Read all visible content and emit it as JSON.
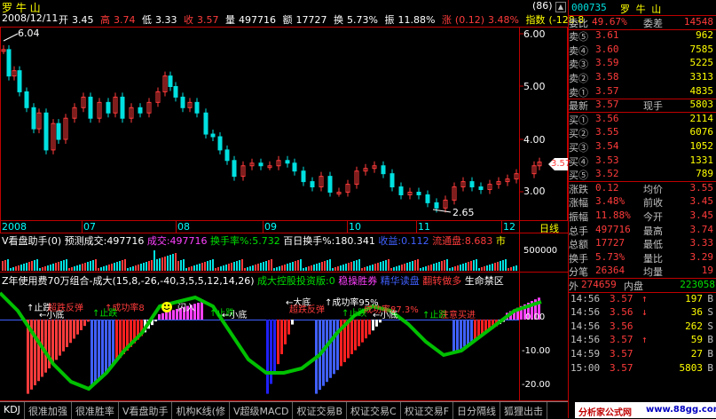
{
  "header": {
    "stock_name": "罗 牛 山",
    "top_right_label": "(86)",
    "date": "2008/12/11",
    "open_label": "开",
    "open": "3.45",
    "high_label": "高",
    "high": "3.74",
    "low_label": "低",
    "low": "3.33",
    "close_label": "收",
    "close": "3.57",
    "volume_label": "量",
    "volume": "497716",
    "amount_label": "额",
    "amount": "17727",
    "turnover_label": "换",
    "turnover": "5.73%",
    "amplitude_label": "振",
    "amplitude": "11.88%",
    "change_label": "涨",
    "change": "(0.12)",
    "change_pct": "3.48%",
    "index_label": "指数",
    "index": "(-128.8"
  },
  "main_chart": {
    "price_axis": [
      "6.00",
      "5.00",
      "4.00",
      "3.00"
    ],
    "max_label": "6.04",
    "min_label": "2.65",
    "current_price_tag": "3.57",
    "months": [
      "2008",
      "07",
      "08",
      "09",
      "10",
      "11",
      "12"
    ],
    "period_label": "日线"
  },
  "volume_panel": {
    "indicator_name": "V看盘助手(0)",
    "predict_label": "预测成交:",
    "predict_value": "497716",
    "deal_label": "成交:",
    "deal_value": "497716",
    "turnover_rate_label": "换手率%:",
    "turnover_rate_value": "5.732",
    "hundred_day_label": "百日换手%:",
    "hundred_day_value": "180.341",
    "profit_label": "收益:",
    "profit_value": "0.112",
    "float_label": "流通盘:",
    "float_value": "8.683",
    "market_label": "市",
    "axis_value": "500000"
  },
  "indicator_panel": {
    "formula_title": "Z年使用费70万组合-成大",
    "params": "(15,8,-26,-40,3,5,5,12,14,26)",
    "tag_green": "成大控股投资版:0",
    "tag_purple": "稳操胜券",
    "tag_blue": "精华读盘",
    "tag_red": "翻转做多",
    "tag_white": "生命禁区",
    "axis": [
      "0.00",
      "-10.00",
      "-20.00"
    ],
    "annotations": [
      {
        "text": "↑止跌",
        "cls": "wht"
      },
      {
        "text": "←小底",
        "cls": "wht"
      },
      {
        "text": "超跌反弹",
        "cls": "red"
      },
      {
        "text": "↑成功率8",
        "cls": "red"
      },
      {
        "text": "↑止跌",
        "cls": "grn"
      },
      {
        "text": "闪入",
        "cls": "wht"
      },
      {
        "text": "↑止跌",
        "cls": "grn"
      },
      {
        "text": "←小底",
        "cls": "wht"
      },
      {
        "text": "←大底",
        "cls": "wht"
      },
      {
        "text": "↑成功率95%",
        "cls": "wht"
      },
      {
        "text": "超跌反弹",
        "cls": "red"
      },
      {
        "text": "↑止跌",
        "cls": "grn"
      },
      {
        "text": "←小底",
        "cls": "wht"
      },
      {
        "text": "成功率87.3%",
        "cls": "red"
      },
      {
        "text": "↑止跌",
        "cls": "grn"
      },
      {
        "text": "注意买进",
        "cls": "red"
      }
    ]
  },
  "quote_panel": {
    "code": "000735",
    "name": "罗 牛 山",
    "ratio_label": "委比",
    "ratio": "49.67%",
    "diff_label": "委差",
    "diff": "14548",
    "asks": [
      {
        "label": "卖⑤",
        "price": "3.61",
        "vol": "962"
      },
      {
        "label": "卖④",
        "price": "3.60",
        "vol": "7585"
      },
      {
        "label": "卖③",
        "price": "3.59",
        "vol": "5225"
      },
      {
        "label": "卖②",
        "price": "3.58",
        "vol": "3313"
      },
      {
        "label": "卖①",
        "price": "3.57",
        "vol": "4835"
      }
    ],
    "last_label": "最新",
    "last": "3.57",
    "hand_label": "现手",
    "hand": "5803",
    "bids": [
      {
        "label": "买①",
        "price": "3.56",
        "vol": "2114"
      },
      {
        "label": "买②",
        "price": "3.55",
        "vol": "6076"
      },
      {
        "label": "买③",
        "price": "3.54",
        "vol": "1052"
      },
      {
        "label": "买④",
        "price": "3.53",
        "vol": "1331"
      },
      {
        "label": "买⑤",
        "price": "3.52",
        "vol": "789"
      }
    ],
    "stats": [
      {
        "l1": "涨跌",
        "v1": "0.12",
        "l2": "均价",
        "v2": "3.55"
      },
      {
        "l1": "涨幅",
        "v1": "3.48%",
        "l2": "前收",
        "v2": "3.45"
      },
      {
        "l1": "振幅",
        "v1": "11.88%",
        "l2": "今开",
        "v2": "3.45"
      },
      {
        "l1": "总手",
        "v1": "497716",
        "l2": "最高",
        "v2": "3.74"
      },
      {
        "l1": "总额",
        "v1": "17727",
        "l2": "最低",
        "v2": "3.33"
      },
      {
        "l1": "换手",
        "v1": "5.73%",
        "l2": "量比",
        "v2": "3.29"
      },
      {
        "l1": "分笔",
        "v1": "26364",
        "l2": "均量",
        "v2": "19"
      }
    ],
    "outer_label": "外",
    "outer": "274659",
    "inner_label": "内盘",
    "inner": "223058",
    "ticks": [
      {
        "time": "14:56",
        "price": "3.57",
        "dir": "↑",
        "vol": "197",
        "side": "B"
      },
      {
        "time": "14:56",
        "price": "3.56",
        "dir": "↓",
        "vol": "36",
        "side": "S"
      },
      {
        "time": "14:56",
        "price": "3.56",
        "dir": "",
        "vol": "262",
        "side": "S"
      },
      {
        "time": "14:56",
        "price": "3.57",
        "dir": "↑",
        "vol": "59",
        "side": "B"
      },
      {
        "time": "14:59",
        "price": "3.57",
        "dir": "",
        "vol": "27",
        "side": "B"
      },
      {
        "time": "15:00",
        "price": "3.57",
        "dir": "",
        "vol": "5803",
        "side": "B"
      }
    ]
  },
  "tabs": [
    "KDJ",
    "很准加强",
    "很准胜率",
    "V看盘助手",
    "机构K线(修",
    "V超级MACD",
    "权证交易B",
    "权证交易C",
    "权证交易F",
    "日分隔线",
    "狐狸出击"
  ],
  "watermark": {
    "site": "分析家公式网",
    "url": "www.88gg.com"
  },
  "colors": {
    "up": "#ff3b3b",
    "down": "#00e0e0",
    "panel_border": "#c00000",
    "accent_yellow": "#ffff00"
  }
}
